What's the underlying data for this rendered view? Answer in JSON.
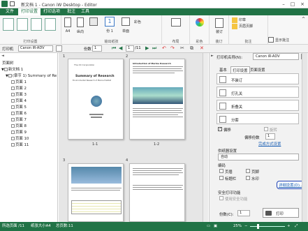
{
  "window": {
    "title": "新文档 1 - Canon iW Desktop - Editor"
  },
  "tabs": [
    "文件",
    "打印设置",
    "打印选项",
    "批注",
    "工具"
  ],
  "ribbon": {
    "groups": [
      {
        "label": "打印设置"
      },
      {
        "label": "输出纸张"
      },
      {
        "label": "布局"
      },
      {
        "label": "彩色"
      },
      {
        "label": "装订"
      },
      {
        "label": "批注"
      }
    ],
    "buttons": {
      "print_size": "A4",
      "orientation": "纵向",
      "pages_per_sheet": "1",
      "copies_label": "份 1",
      "duplex": "单面",
      "color": "彩色",
      "binding": "装订",
      "stamp": "印章",
      "header_footer": "页眉页脚",
      "show_annotation": "显示批注"
    }
  },
  "toolbar": {
    "printer_label": "打印机",
    "printer_value": "Canon iR-ADV",
    "copies_label": "份数",
    "copies_value": "1",
    "page_current": "1",
    "page_total": "/11"
  },
  "left": {
    "title": "页面树",
    "root": "新文档 1",
    "group": "(章节 1) Summary of Re",
    "pages": [
      "页面 1",
      "页面 2",
      "页面 3",
      "页面 4",
      "页面 5",
      "页面 6",
      "页面 7",
      "页面 8",
      "页面 9",
      "页面 10",
      "页面 11"
    ]
  },
  "center": {
    "page_labels": [
      "1",
      "2",
      "3",
      "4"
    ],
    "page_captions": [
      "1-1",
      "1-2"
    ],
    "p1_title": "Summary of Research",
    "p1_sub": "Environmental Research of Marine Habitat",
    "p1_small": "The XX Corporation",
    "p2_head": "Introduction of Marine Research"
  },
  "right": {
    "printer_label": "打印机名称(N):",
    "printer_value": "Canon iR-ADV",
    "tabs": [
      "基本",
      "打印设置",
      "页面设置"
    ],
    "binding_value": "不装订",
    "punch_value": "打孔关",
    "fold_value": "折叠关",
    "staple_value": "分套",
    "offset_label": "偏移",
    "sort_label": "旋转",
    "offset_count_label": "偏移份数",
    "offset_count": "1",
    "finishing_link": "完成方式设置",
    "output_label": "供纸器设置",
    "output_value": "自动",
    "stamp_section": "编码",
    "stamp_opts": [
      "页眉",
      "页脚",
      "标题栏",
      "水印"
    ],
    "detail_button": "详细设置(D)...",
    "secure_label": "安全打印功能",
    "secure_opt": "使用安全功能",
    "copies_label": "份数(C):",
    "copies_value": "1",
    "print_button": "打印"
  },
  "status": {
    "selected": "所选页面 /11",
    "size": "纸张大小A4",
    "pages": "总页数:11",
    "zoom": "25%"
  }
}
